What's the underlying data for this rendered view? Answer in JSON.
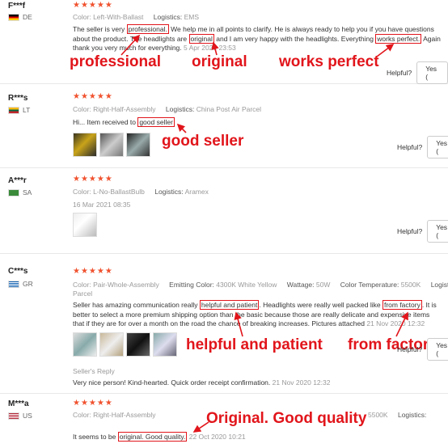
{
  "reviews": [
    {
      "user": "F***f",
      "country": "DE",
      "stars": "★★★★★",
      "color_label": "Color:",
      "color_value": "Left-With-Ballast",
      "logistics_label": "Logistics:",
      "logistics_value": "EMS",
      "text_a": "The seller is very ",
      "hl1": "professional.",
      "text_b": " We help me in all points to clarify. He is always ready to help you if you have questions about the product. The headlights are ",
      "hl2": "original",
      "text_c": " and I am very happy with the headlights. Everything ",
      "hl3": "works perfect.",
      "text_d": " Again thank you very much for everything. ",
      "date": "5 Apr 2021 23:53",
      "helpful_label": "Helpful?",
      "yes_label": "Yes ("
    },
    {
      "user": "R***s",
      "country": "LT",
      "stars": "★★★★★",
      "color_label": "Color:",
      "color_value": "Right-Half-Assembly",
      "logistics_label": "Logistics:",
      "logistics_value": "China Post Air Parcel",
      "text_a": "Hi... Item received to ",
      "hl1": "good seller",
      "helpful_label": "Helpful?",
      "yes_label": "Yes ("
    },
    {
      "user": "A***r",
      "country": "SA",
      "stars": "★★★★★",
      "color_label": "Color:",
      "color_value": "L-No-BallastBulb",
      "logistics_label": "Logistics:",
      "logistics_value": "Aramex",
      "date": "16 Mar 2021 08:35",
      "helpful_label": "Helpful?",
      "yes_label": "Yes ("
    },
    {
      "user": "C***s",
      "country": "GR",
      "stars": "★★★★★",
      "color_label": "Color:",
      "color_value": "Pair-Whole-Assembly",
      "emit_label": "Emitting Color:",
      "emit_value": "4300K White Yellow",
      "watt_label": "Wattage:",
      "watt_value": "50W",
      "temp_label": "Color Temperature:",
      "temp_value": "5500K",
      "logistics_label": "Logistics",
      "logistics_value": "Parcel",
      "text_a": "Seller has amazing communication really ",
      "hl1": "helpful and patient",
      "text_b": ". Headlights were really well packed like ",
      "hl2": "from factory",
      "text_c": ". It is better to select a more premium shipping option than the basic because those are really delicate and expensive items that if they are for over a month on the road the chance of breaking increases. Pictures attached ",
      "date": "21 Nov 2020 12:32",
      "reply_heading": "Seller's Reply",
      "reply_text": "Very nice person! Kind-hearted. Quick order receipt confirmation. ",
      "reply_date": "21 Nov 2020 12:32",
      "helpful_label": "Helpful?",
      "yes_label": "Yes ("
    },
    {
      "user": "M***a",
      "country": "US",
      "stars": "★★★★★",
      "color_label": "Color:",
      "color_value": "Right-Half-Assembly",
      "temp_label": "Color Temperature:",
      "temp_value": "5500K",
      "logistics_label": "Logistics:",
      "logistics_value": "",
      "text_a": "It seems to be ",
      "hl1": "original. Good quality.",
      "date": "22 Oct 2020 10:21"
    }
  ],
  "annotations": {
    "professional": "professional",
    "original": "original",
    "works_perfect": "works perfect",
    "good_seller": "good seller",
    "helpful_patient": "helpful and patient",
    "from_factory": "from factory",
    "original_quality": "Original. Good quality"
  },
  "colors": {
    "accent": "#e1151b",
    "stars": "#f0522f"
  },
  "flags": {
    "DE": "flag-de",
    "LT": "flag-lt",
    "SA": "flag-sa",
    "GR": "flag-gr",
    "US": "flag-us"
  }
}
